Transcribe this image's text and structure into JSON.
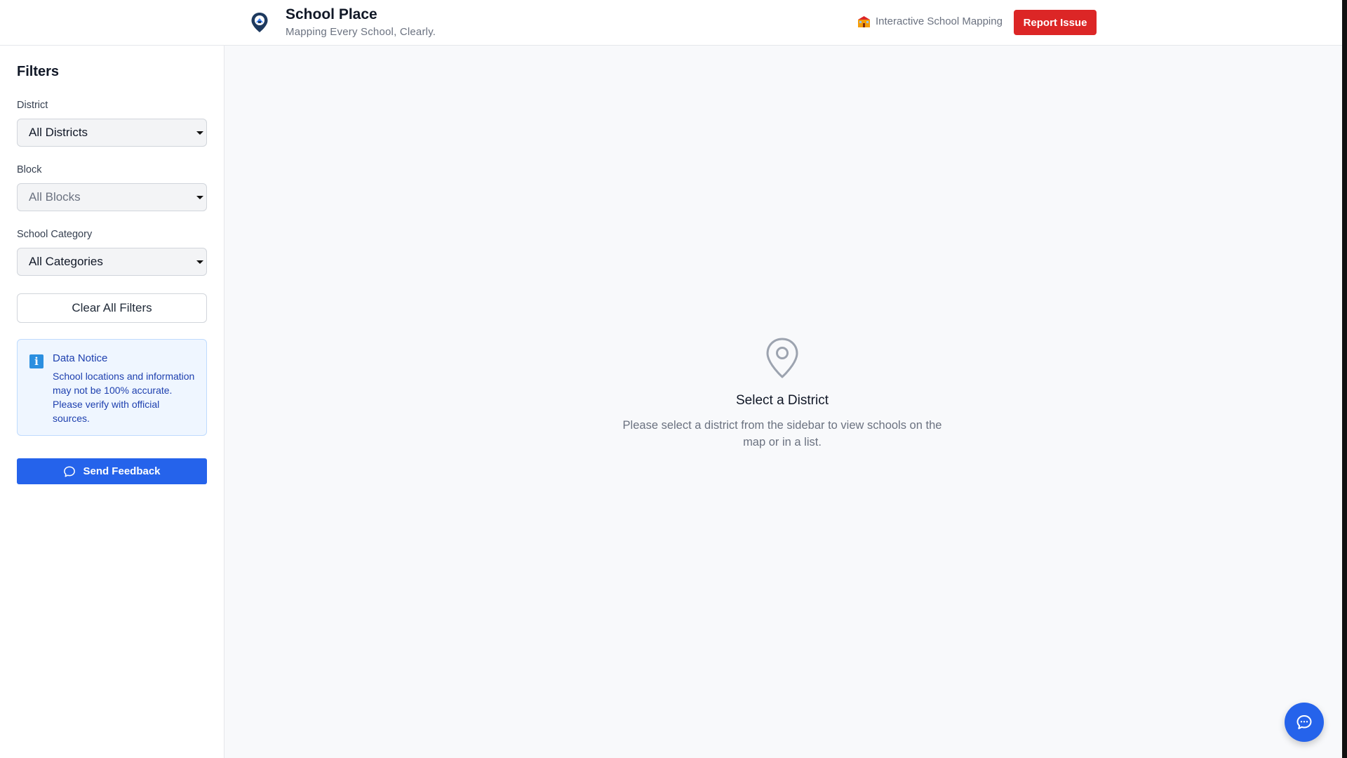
{
  "header": {
    "title": "School Place",
    "subtitle": "Mapping Every School, Clearly.",
    "badge_text": "Interactive School Mapping",
    "report_label": "Report Issue"
  },
  "sidebar": {
    "title": "Filters",
    "district": {
      "label": "District",
      "value": "All Districts"
    },
    "block": {
      "label": "Block",
      "value": "All Blocks"
    },
    "category": {
      "label": "School Category",
      "value": "All Categories"
    },
    "clear_label": "Clear All Filters",
    "notice": {
      "icon": "i",
      "title": "Data Notice",
      "text": "School locations and information may not be 100% accurate. Please verify with official sources."
    },
    "feedback_label": "Send Feedback"
  },
  "main": {
    "empty_title": "Select a District",
    "empty_text": "Please select a district from the sidebar to view schools on the map or in a list."
  },
  "colors": {
    "accent": "#2563eb",
    "danger": "#dc2626",
    "notice_bg": "#eff6ff"
  },
  "icons": {
    "logo": "map-pin-logo-icon",
    "badge": "school-emoji-icon",
    "info": "info-icon",
    "feedback": "chat-bubble-icon",
    "empty": "location-pin-icon",
    "fab": "chat-bubble-icon"
  }
}
